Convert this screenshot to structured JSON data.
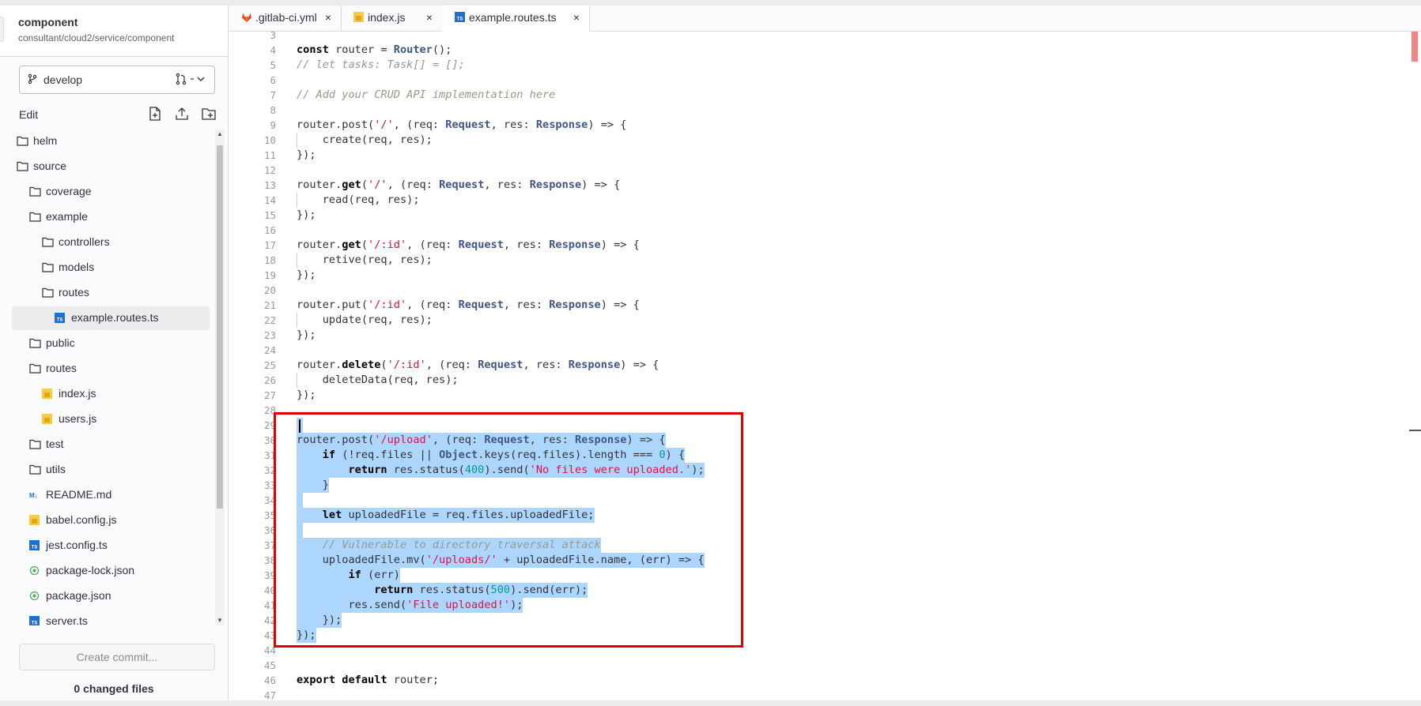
{
  "project": {
    "name": "component",
    "path": "consultant/cloud2/service/component"
  },
  "branch": {
    "name": "develop",
    "mr_suffix": "-"
  },
  "edit_label": "Edit",
  "file_tree": [
    {
      "label": "helm",
      "type": "folder"
    },
    {
      "label": "source",
      "type": "folder"
    },
    {
      "label": "coverage",
      "type": "folder"
    },
    {
      "label": "example",
      "type": "folder"
    },
    {
      "label": "controllers",
      "type": "folder"
    },
    {
      "label": "models",
      "type": "folder"
    },
    {
      "label": "routes",
      "type": "folder"
    },
    {
      "label": "example.routes.ts",
      "type": "ts",
      "active": true
    },
    {
      "label": "public",
      "type": "folder"
    },
    {
      "label": "routes",
      "type": "folder"
    },
    {
      "label": "index.js",
      "type": "js"
    },
    {
      "label": "users.js",
      "type": "js"
    },
    {
      "label": "test",
      "type": "folder"
    },
    {
      "label": "utils",
      "type": "folder"
    },
    {
      "label": "README.md",
      "type": "md"
    },
    {
      "label": "babel.config.js",
      "type": "js"
    },
    {
      "label": "jest.config.ts",
      "type": "ts"
    },
    {
      "label": "package-lock.json",
      "type": "json"
    },
    {
      "label": "package.json",
      "type": "json"
    },
    {
      "label": "server.ts",
      "type": "ts"
    }
  ],
  "commit_button": "Create commit...",
  "changed_files": "0 changed files",
  "tabs": [
    {
      "label": ".gitlab-ci.yml",
      "icon": "gitlab-icon"
    },
    {
      "label": "index.js",
      "icon": "js-file-icon"
    },
    {
      "label": "example.routes.ts",
      "icon": "ts-file-icon",
      "active": true
    }
  ],
  "tab_close_glyph": "×",
  "code_lines": [
    {
      "n": "3",
      "t": ""
    },
    {
      "n": "4",
      "t": "const router = Router();"
    },
    {
      "n": "5",
      "t": "// let tasks: Task[] = [];"
    },
    {
      "n": "6",
      "t": ""
    },
    {
      "n": "7",
      "t": "// Add your CRUD API implementation here"
    },
    {
      "n": "8",
      "t": ""
    },
    {
      "n": "9",
      "t": "router.post('/', (req: Request, res: Response) => {"
    },
    {
      "n": "10",
      "t": "    create(req, res);"
    },
    {
      "n": "11",
      "t": "});"
    },
    {
      "n": "12",
      "t": ""
    },
    {
      "n": "13",
      "t": "router.get('/', (req: Request, res: Response) => {"
    },
    {
      "n": "14",
      "t": "    read(req, res);"
    },
    {
      "n": "15",
      "t": "});"
    },
    {
      "n": "16",
      "t": ""
    },
    {
      "n": "17",
      "t": "router.get('/:id', (req: Request, res: Response) => {"
    },
    {
      "n": "18",
      "t": "    retive(req, res);"
    },
    {
      "n": "19",
      "t": "});"
    },
    {
      "n": "20",
      "t": ""
    },
    {
      "n": "21",
      "t": "router.put('/:id', (req: Request, res: Response) => {"
    },
    {
      "n": "22",
      "t": "    update(req, res);"
    },
    {
      "n": "23",
      "t": "});"
    },
    {
      "n": "24",
      "t": ""
    },
    {
      "n": "25",
      "t": "router.delete('/:id', (req: Request, res: Response) => {"
    },
    {
      "n": "26",
      "t": "    deleteData(req, res);"
    },
    {
      "n": "27",
      "t": "});"
    },
    {
      "n": "28",
      "t": ""
    },
    {
      "n": "29",
      "t": "",
      "sel": true
    },
    {
      "n": "30",
      "t": "router.post('/upload', (req: Request, res: Response) => {",
      "sel": true
    },
    {
      "n": "31",
      "t": "    if (!req.files || Object.keys(req.files).length === 0) {",
      "sel": true
    },
    {
      "n": "32",
      "t": "        return res.status(400).send('No files were uploaded.');",
      "sel": true
    },
    {
      "n": "33",
      "t": "    }",
      "sel": true
    },
    {
      "n": "34",
      "t": "",
      "sel": true
    },
    {
      "n": "35",
      "t": "    let uploadedFile = req.files.uploadedFile;",
      "sel": true
    },
    {
      "n": "36",
      "t": "",
      "sel": true
    },
    {
      "n": "37",
      "t": "    // Vulnerable to directory traversal attack",
      "sel": true
    },
    {
      "n": "38",
      "t": "    uploadedFile.mv('/uploads/' + uploadedFile.name, (err) => {",
      "sel": true
    },
    {
      "n": "39",
      "t": "        if (err)",
      "sel": true
    },
    {
      "n": "40",
      "t": "            return res.status(500).send(err);",
      "sel": true
    },
    {
      "n": "41",
      "t": "        res.send('File uploaded!');",
      "sel": true
    },
    {
      "n": "42",
      "t": "    });",
      "sel": true
    },
    {
      "n": "43",
      "t": "});",
      "sel": true
    },
    {
      "n": "44",
      "t": ""
    },
    {
      "n": "45",
      "t": ""
    },
    {
      "n": "46",
      "t": "export default router;"
    },
    {
      "n": "47",
      "t": ""
    }
  ],
  "colors": {
    "selection": "#add6ff",
    "highlight_box": "#e00000",
    "accent_ts": "#1f6fd1",
    "accent_js": "#f7c948"
  }
}
